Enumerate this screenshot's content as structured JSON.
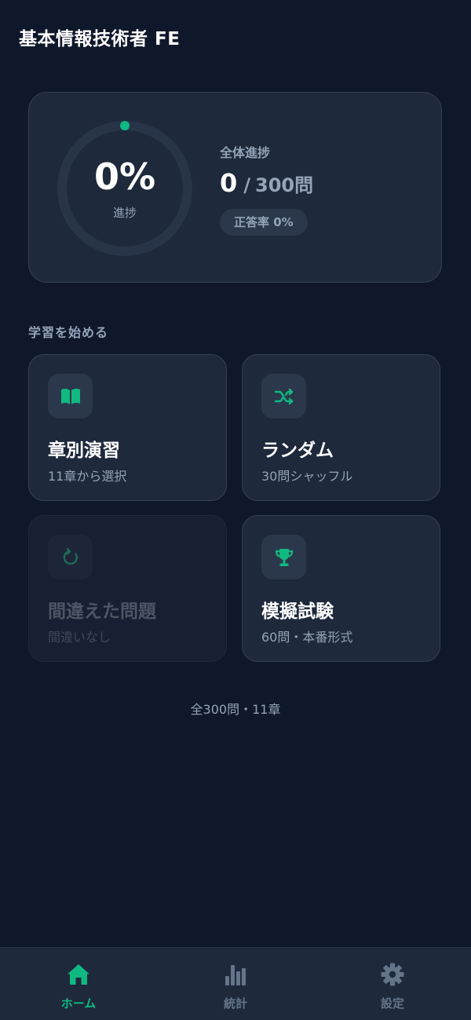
{
  "app": {
    "title": "基本情報技術者 FE"
  },
  "progress": {
    "percent_text": "0%",
    "percent_value": 0,
    "ring_label": "進捗",
    "overall_label": "全体進捗",
    "done": "0",
    "separator": "/",
    "total": "300問",
    "accuracy": "正答率 0%"
  },
  "section": {
    "title": "学習を始める"
  },
  "modes": [
    {
      "title": "章別演習",
      "subtitle": "11章から選択",
      "icon": "book-icon",
      "enabled": true
    },
    {
      "title": "ランダム",
      "subtitle": "30問シャッフル",
      "icon": "shuffle-icon",
      "enabled": true
    },
    {
      "title": "間違えた問題",
      "subtitle": "間違いなし",
      "icon": "retry-icon",
      "enabled": false
    },
    {
      "title": "模擬試験",
      "subtitle": "60問・本番形式",
      "icon": "trophy-icon",
      "enabled": true
    }
  ],
  "footer": {
    "note": "全300問・11章"
  },
  "tabs": [
    {
      "label": "ホーム",
      "icon": "home-icon",
      "active": true
    },
    {
      "label": "統計",
      "icon": "bar-chart-icon",
      "active": false
    },
    {
      "label": "設定",
      "icon": "gear-icon",
      "active": false
    }
  ],
  "colors": {
    "background": "#0f172a",
    "card": "#1e293b",
    "accent": "#10b981",
    "muted_text": "#94a3b8",
    "inactive_tab": "#64748b"
  }
}
